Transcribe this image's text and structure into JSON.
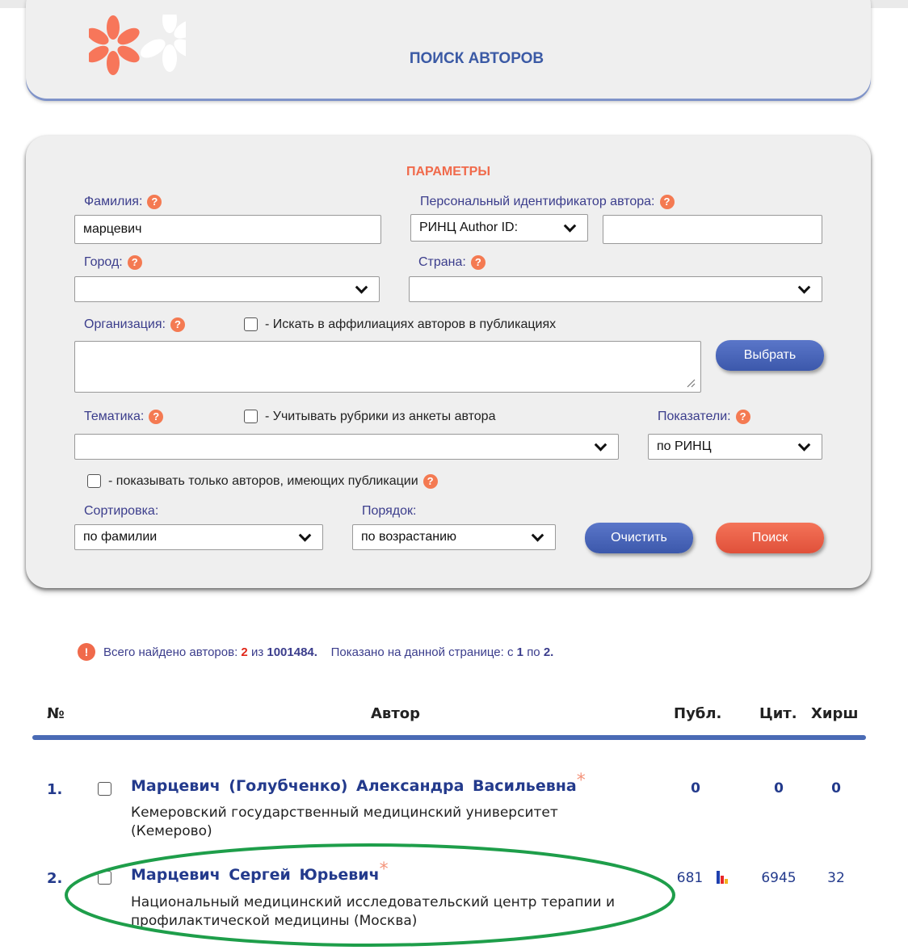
{
  "header": {
    "title": "ПОИСК АВТОРОВ"
  },
  "params": {
    "title": "ПАРАМЕТРЫ",
    "surname_label": "Фамилия:",
    "surname_value": "марцевич",
    "author_id_label": "Персональный идентификатор автора:",
    "author_id_type": "РИНЦ Author ID:",
    "author_id_value": "",
    "city_label": "Город:",
    "city_value": "",
    "country_label": "Страна:",
    "country_value": "",
    "org_label": "Организация:",
    "org_affil_checkbox": "- Искать в аффилиациях авторов в публикациях",
    "org_value": "",
    "choose_button": "Выбрать",
    "topic_label": "Тематика:",
    "topic_checkbox": "- Учитывать рубрики из анкеты автора",
    "topic_value": "",
    "indicators_label": "Показатели:",
    "indicators_value": "по РИНЦ",
    "only_with_pubs_checkbox": "- показывать только авторов, имеющих публикации",
    "sort_label": "Сортировка:",
    "sort_value": "по фамилии",
    "order_label": "Порядок:",
    "order_value": "по возрастанию",
    "clear_button": "Очистить",
    "search_button": "Поиск",
    "help_icon": "question-icon"
  },
  "summary": {
    "prefix": "Всего найдено авторов:",
    "found": "2",
    "of_word": "из",
    "total": "1001484.",
    "shown_prefix": "Показано на данной странице: с",
    "from": "1",
    "to_word": "по",
    "to": "2."
  },
  "columns": {
    "num": "№",
    "author": "Автор",
    "pubs": "Публ.",
    "cites": "Цит.",
    "hirsch": "Хирш"
  },
  "results": [
    {
      "num": "1.",
      "name": "Марцевич (Голубченко) Александра Васильевна",
      "star": "*",
      "aff1": "Кемеровский государственный медицинский университет",
      "aff2": "(Кемерово)",
      "pubs": "0",
      "cites": "0",
      "hirsch": "0"
    },
    {
      "num": "2.",
      "name": "Марцевич Сергей Юрьевич",
      "star": "*",
      "aff1": "Национальный медицинский исследовательский центр терапии и",
      "aff2": "профилактической медицины (Москва)",
      "pubs": "681",
      "cites": "6945",
      "hirsch": "32"
    }
  ],
  "colors": {
    "accent_blue": "#3b5aa5",
    "accent_red": "#f06a4b",
    "highlight": "#1e9e4a"
  }
}
